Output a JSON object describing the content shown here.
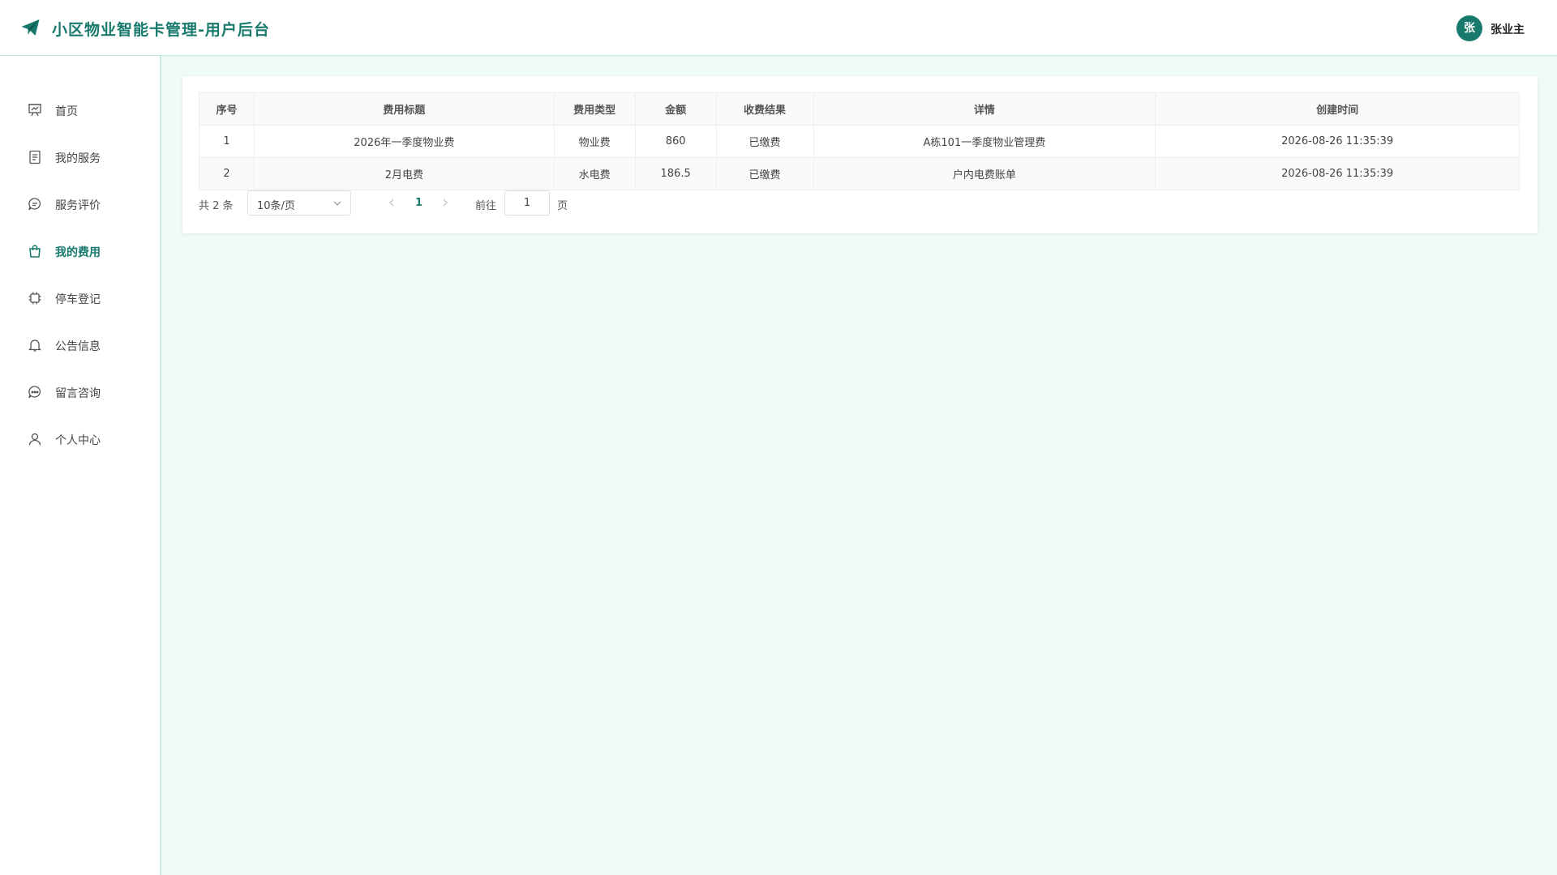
{
  "header": {
    "title": "小区物业智能卡管理-用户后台",
    "avatar_text": "张",
    "username": "张业主"
  },
  "sidebar": {
    "items": [
      {
        "label": "首页",
        "icon": "presentation-icon",
        "active": false
      },
      {
        "label": "我的服务",
        "icon": "document-icon",
        "active": false
      },
      {
        "label": "服务评价",
        "icon": "chat-bubble-icon",
        "active": false
      },
      {
        "label": "我的费用",
        "icon": "shopping-bag-icon",
        "active": true
      },
      {
        "label": "停车登记",
        "icon": "cpu-icon",
        "active": false
      },
      {
        "label": "公告信息",
        "icon": "bell-icon",
        "active": false
      },
      {
        "label": "留言咨询",
        "icon": "message-dots-icon",
        "active": false
      },
      {
        "label": "个人中心",
        "icon": "user-icon",
        "active": false
      }
    ]
  },
  "table": {
    "columns": [
      "序号",
      "费用标题",
      "费用类型",
      "金额",
      "收费结果",
      "详情",
      "创建时间"
    ],
    "rows": [
      [
        "1",
        "2026年一季度物业费",
        "物业费",
        "860",
        "已缴费",
        "A栋101一季度物业管理费",
        "2026-08-26 11:35:39"
      ],
      [
        "2",
        "2月电费",
        "水电费",
        "186.5",
        "已缴费",
        "户内电费账单",
        "2026-08-26 11:35:39"
      ]
    ]
  },
  "pagination": {
    "total": "共 2 条",
    "page_size": "10条/页",
    "current_page": "1",
    "goto_label": "前往",
    "goto_value": "1",
    "page_suffix": "页"
  },
  "colors": {
    "accent": "#177a6c",
    "background": "#f0fbf8"
  }
}
